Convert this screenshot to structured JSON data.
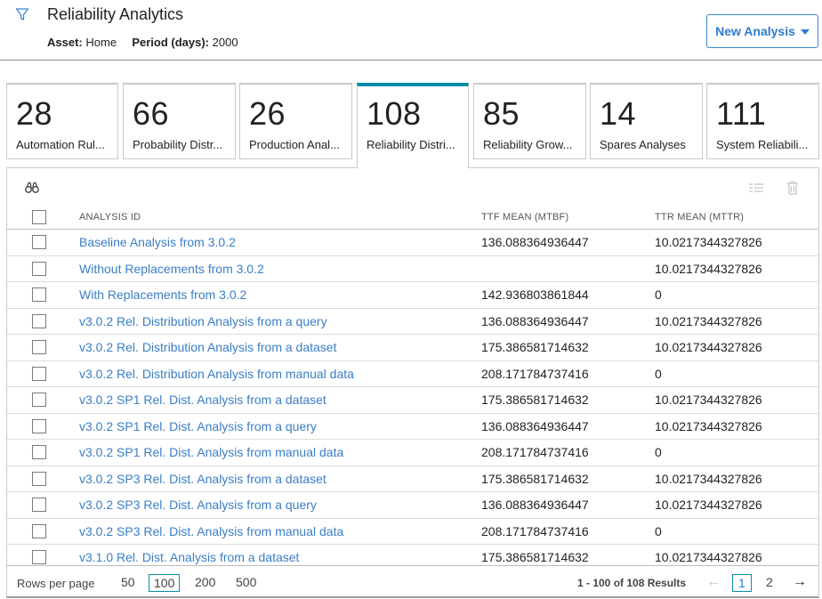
{
  "header": {
    "title": "Reliability Analytics",
    "asset_label": "Asset:",
    "asset_value": "Home",
    "period_label": "Period (days):",
    "period_value": "2000",
    "new_button": "New Analysis"
  },
  "tiles": [
    {
      "count": "28",
      "label": "Automation Rul..."
    },
    {
      "count": "66",
      "label": "Probability Distr..."
    },
    {
      "count": "26",
      "label": "Production Anal..."
    },
    {
      "count": "108",
      "label": "Reliability Distri..."
    },
    {
      "count": "85",
      "label": "Reliability Grow..."
    },
    {
      "count": "14",
      "label": "Spares Analyses"
    },
    {
      "count": "111",
      "label": "System Reliabili..."
    }
  ],
  "table": {
    "columns": [
      "ANALYSIS ID",
      "TTF MEAN (MTBF)",
      "TTR MEAN (MTTR)"
    ],
    "rows": [
      {
        "id": "Baseline Analysis from 3.0.2",
        "ttf": "136.088364936447",
        "ttr": "10.0217344327826"
      },
      {
        "id": "Without Replacements from 3.0.2",
        "ttf": "",
        "ttr": "10.0217344327826"
      },
      {
        "id": "With Replacements from 3.0.2",
        "ttf": "142.936803861844",
        "ttr": "0"
      },
      {
        "id": "v3.0.2 Rel. Distribution Analysis from a query",
        "ttf": "136.088364936447",
        "ttr": "10.0217344327826"
      },
      {
        "id": "v3.0.2 Rel. Distribution Analysis from a dataset",
        "ttf": "175.386581714632",
        "ttr": "10.0217344327826"
      },
      {
        "id": "v3.0.2 Rel. Distribution Analysis from manual data",
        "ttf": "208.171784737416",
        "ttr": "0"
      },
      {
        "id": "v3.0.2 SP1 Rel. Dist. Analysis from a dataset",
        "ttf": "175.386581714632",
        "ttr": "10.0217344327826"
      },
      {
        "id": "v3.0.2 SP1 Rel. Dist. Analysis from a query",
        "ttf": "136.088364936447",
        "ttr": "10.0217344327826"
      },
      {
        "id": "v3.0.2 SP1 Rel. Dist. Analysis from manual data",
        "ttf": "208.171784737416",
        "ttr": "0"
      },
      {
        "id": "v3.0.2 SP3 Rel. Dist. Analysis from a dataset",
        "ttf": "175.386581714632",
        "ttr": "10.0217344327826"
      },
      {
        "id": "v3.0.2 SP3 Rel. Dist. Analysis from a query",
        "ttf": "136.088364936447",
        "ttr": "10.0217344327826"
      },
      {
        "id": "v3.0.2 SP3 Rel. Dist. Analysis from manual data",
        "ttf": "208.171784737416",
        "ttr": "0"
      },
      {
        "id": "v3.1.0 Rel. Dist. Analysis from a dataset",
        "ttf": "175.386581714632",
        "ttr": "10.0217344327826"
      }
    ]
  },
  "footer": {
    "rows_per_page_label": "Rows per page",
    "page_sizes": [
      "50",
      "100",
      "200",
      "500"
    ],
    "selected_page_size": "100",
    "results_text": "1 - 100 of 108 Results",
    "pages": [
      "1",
      "2"
    ],
    "current_page": "1"
  },
  "icons": {
    "filter": "filter-funnel-icon",
    "search": "binoculars-icon",
    "columns": "list-columns-icon",
    "delete": "trash-icon",
    "prev": "arrow-left-icon",
    "next": "arrow-right-icon"
  },
  "colors": {
    "accent": "#0b8ca8",
    "link": "#3a7ec6",
    "button_text": "#2f7bd0"
  }
}
